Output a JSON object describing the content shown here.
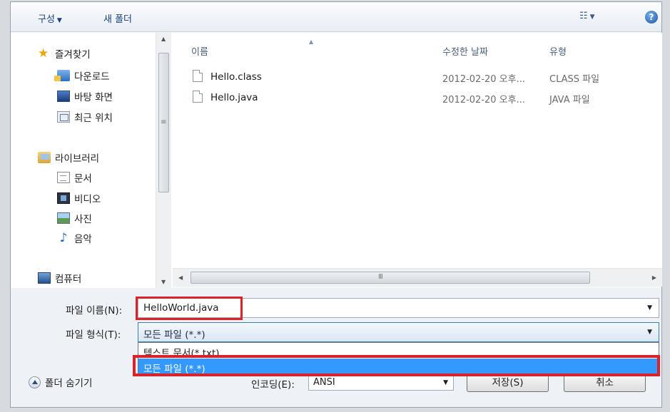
{
  "toolbar": {
    "organize": "구성",
    "new_folder": "새 폴더",
    "view_icon": "view-list-icon",
    "help_glyph": "?"
  },
  "nav": {
    "favorites": "즐겨찾기",
    "downloads": "다운로드",
    "desktop": "바탕 화면",
    "recent": "최근 위치",
    "libraries": "라이브러리",
    "documents": "문서",
    "videos": "비디오",
    "pictures": "사진",
    "music": "음악",
    "computer": "컴퓨터"
  },
  "list": {
    "columns": {
      "name": "이름",
      "date": "수정한 날짜",
      "type": "유형"
    },
    "files": [
      {
        "name": "Hello.class",
        "date": "2012-02-20 오후...",
        "type": "CLASS 파일"
      },
      {
        "name": "Hello.java",
        "date": "2012-02-20 오후...",
        "type": "JAVA 파일"
      }
    ],
    "scroll_grip": "III"
  },
  "form": {
    "filename_label": "파일 이름(N):",
    "filename_value": "HelloWorld.java",
    "filetype_label": "파일 형식(T):",
    "filetype_value": "모든 파일 (*.*)",
    "options": [
      "텍스트 문서(*.txt)",
      "모든 파일 (*.*)"
    ],
    "hide_folders": "폴더 숨기기",
    "encoding_label": "인코딩(E):",
    "encoding_value": "ANSI",
    "save_button": "저장(S)",
    "cancel_button": "취소"
  },
  "colors": {
    "highlight_box": "#d8232a",
    "selected_option": "#3399ff"
  }
}
